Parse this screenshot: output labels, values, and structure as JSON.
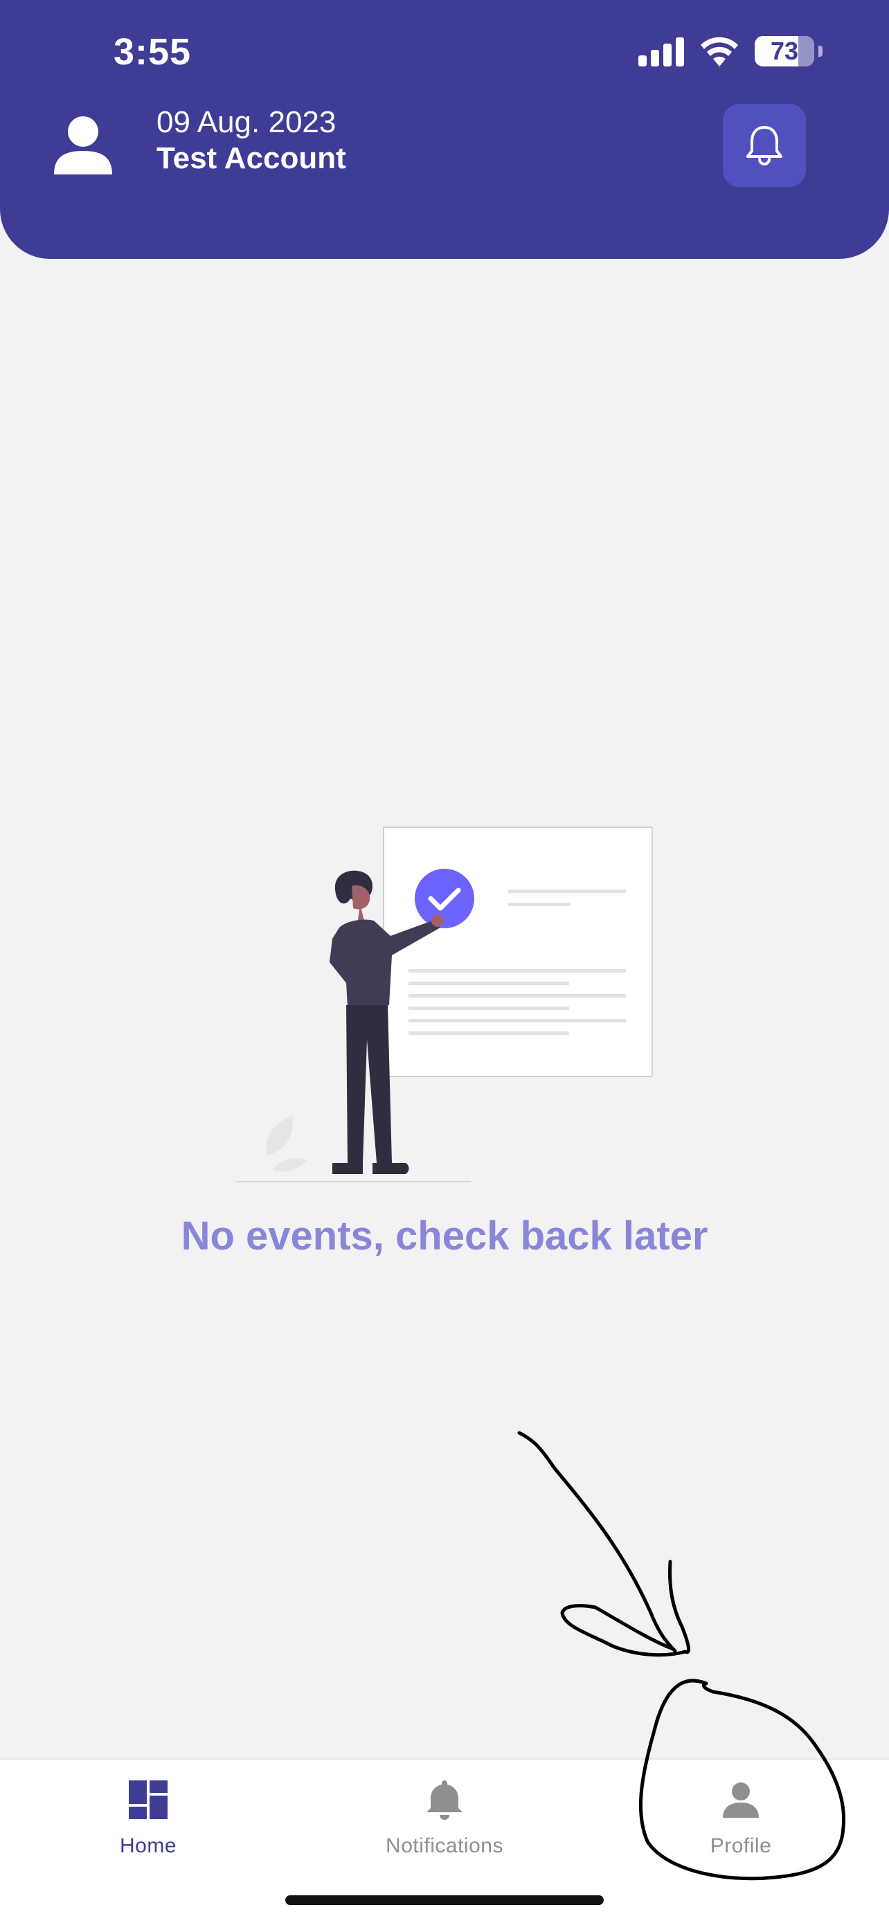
{
  "status_bar": {
    "time": "3:55",
    "battery": "73"
  },
  "header": {
    "date": "09 Aug. 2023",
    "account_name": "Test Account"
  },
  "main": {
    "empty_message": "No events, check back later"
  },
  "tab_bar": {
    "tabs": [
      {
        "label": "Home",
        "icon": "dashboard-icon",
        "active": true
      },
      {
        "label": "Notifications",
        "icon": "bell-icon",
        "active": false
      },
      {
        "label": "Profile",
        "icon": "person-icon",
        "active": false
      }
    ]
  },
  "colors": {
    "header_background": "#3f3c96",
    "accent": "#6c63ff",
    "empty_text": "#8886d8",
    "inactive_tab": "#8f8f8f"
  }
}
